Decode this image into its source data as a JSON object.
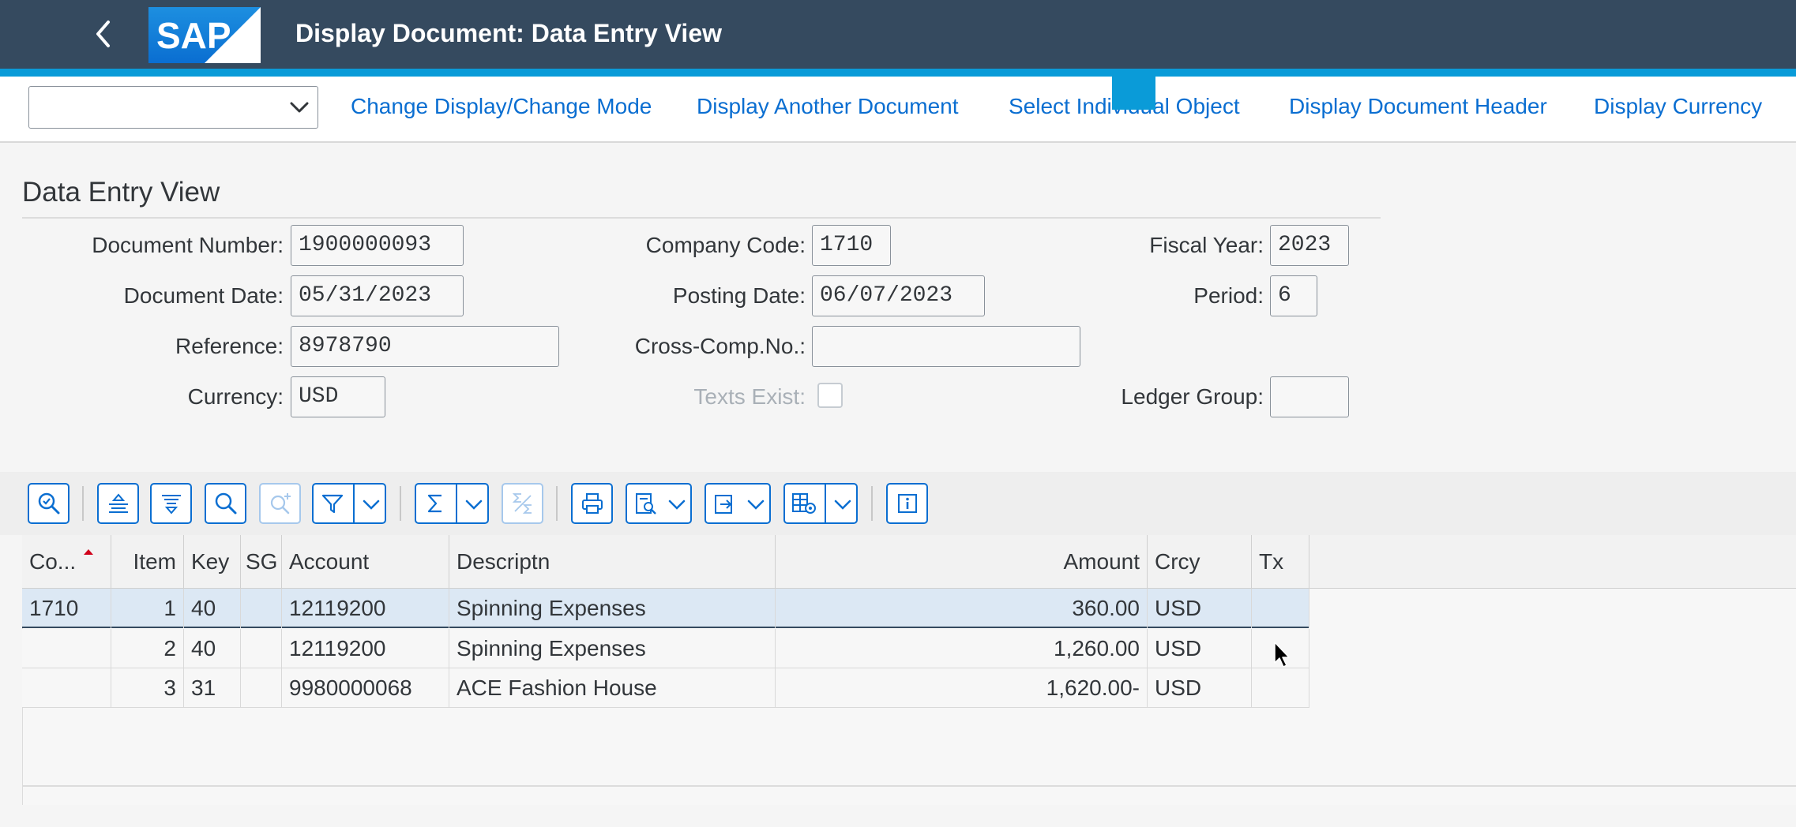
{
  "shell": {
    "title": "Display Document: Data Entry View",
    "logo_text": "SAP",
    "colors": {
      "header_bg": "#354a5f",
      "accent": "#0a9bd8",
      "link": "#0a6ed1"
    }
  },
  "toolbar": {
    "combo_value": "",
    "actions": [
      "Change Display/Change Mode",
      "Display Another Document",
      "Select Individual Object",
      "Display Document Header",
      "Display Currency"
    ]
  },
  "section": {
    "title": "Data Entry View",
    "fields": {
      "document_number": {
        "label": "Document Number:",
        "value": "1900000093"
      },
      "company_code": {
        "label": "Company Code:",
        "value": "1710"
      },
      "fiscal_year": {
        "label": "Fiscal Year:",
        "value": "2023"
      },
      "document_date": {
        "label": "Document Date:",
        "value": "05/31/2023"
      },
      "posting_date": {
        "label": "Posting Date:",
        "value": "06/07/2023"
      },
      "period": {
        "label": "Period:",
        "value": "6"
      },
      "reference": {
        "label": "Reference:",
        "value": "8978790"
      },
      "cross_comp_no": {
        "label": "Cross-Comp.No.:",
        "value": ""
      },
      "currency": {
        "label": "Currency:",
        "value": "USD"
      },
      "texts_exist": {
        "label": "Texts Exist:",
        "checked": false
      },
      "ledger_group": {
        "label": "Ledger Group:",
        "value": ""
      }
    }
  },
  "alv_toolbar": {
    "icons": [
      "details-icon",
      "sort-ascending-icon",
      "sort-descending-icon",
      "find-icon",
      "find-next-icon",
      "filter-icon",
      "total-icon",
      "subtotal-icon",
      "print-icon",
      "views-icon",
      "export-icon",
      "layout-icon",
      "information-icon"
    ]
  },
  "table": {
    "columns": [
      "Co...",
      "Item",
      "Key",
      "SG",
      "Account",
      "Descriptn",
      "Amount",
      "Crcy",
      "Tx"
    ],
    "rows": [
      {
        "company": "1710",
        "item": "1",
        "key": "40",
        "sg": "",
        "account": "12119200",
        "description": "Spinning Expenses",
        "amount": "360.00",
        "currency": "USD",
        "tx": ""
      },
      {
        "company": "",
        "item": "2",
        "key": "40",
        "sg": "",
        "account": "12119200",
        "description": "Spinning Expenses",
        "amount": "1,260.00",
        "currency": "USD",
        "tx": ""
      },
      {
        "company": "",
        "item": "3",
        "key": "31",
        "sg": "",
        "account": "9980000068",
        "description": "ACE Fashion House",
        "amount": "1,620.00-",
        "currency": "USD",
        "tx": ""
      }
    ]
  }
}
